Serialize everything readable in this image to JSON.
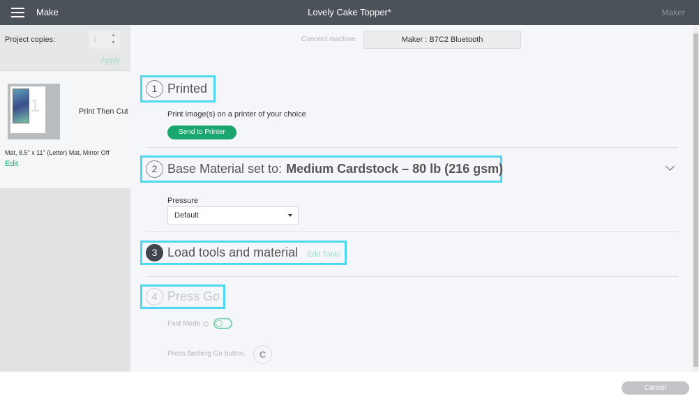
{
  "topbar": {
    "make": "Make",
    "title": "Lovely Cake Topper*",
    "machine": "Maker"
  },
  "left": {
    "copies_label": "Project copies:",
    "copies_value": "1",
    "apply": "Apply",
    "mat_type": "Print Then Cut",
    "mat_info": "Mat, 8.5\" x 11\" (Letter) Mat, Mirror Off",
    "edit": "Edit"
  },
  "connect": {
    "label": "Connect machine",
    "machine": "Maker : B7C2 Bluetooth"
  },
  "steps": [
    {
      "num": "1",
      "title": "Printed",
      "desc": "Print image(s) on a printer of your choice",
      "button": "Send to Printer"
    },
    {
      "num": "2",
      "title": "Base Material set to: ",
      "material": "Medium Cardstock – 80 lb (216 gsm)",
      "pressure_label": "Pressure",
      "pressure_value": "Default"
    },
    {
      "num": "3",
      "title": "Load tools and material",
      "link": "Edit Tools"
    },
    {
      "num": "4",
      "title": "Press Go",
      "fast_mode": "Fast Mode",
      "press_text": "Press flashing Go button."
    }
  ],
  "footer": {
    "cancel": "Cancel"
  },
  "colors": {
    "accent": "#1aa76e",
    "highlight": "#4dd8f0",
    "topbar": "#4b5259"
  }
}
